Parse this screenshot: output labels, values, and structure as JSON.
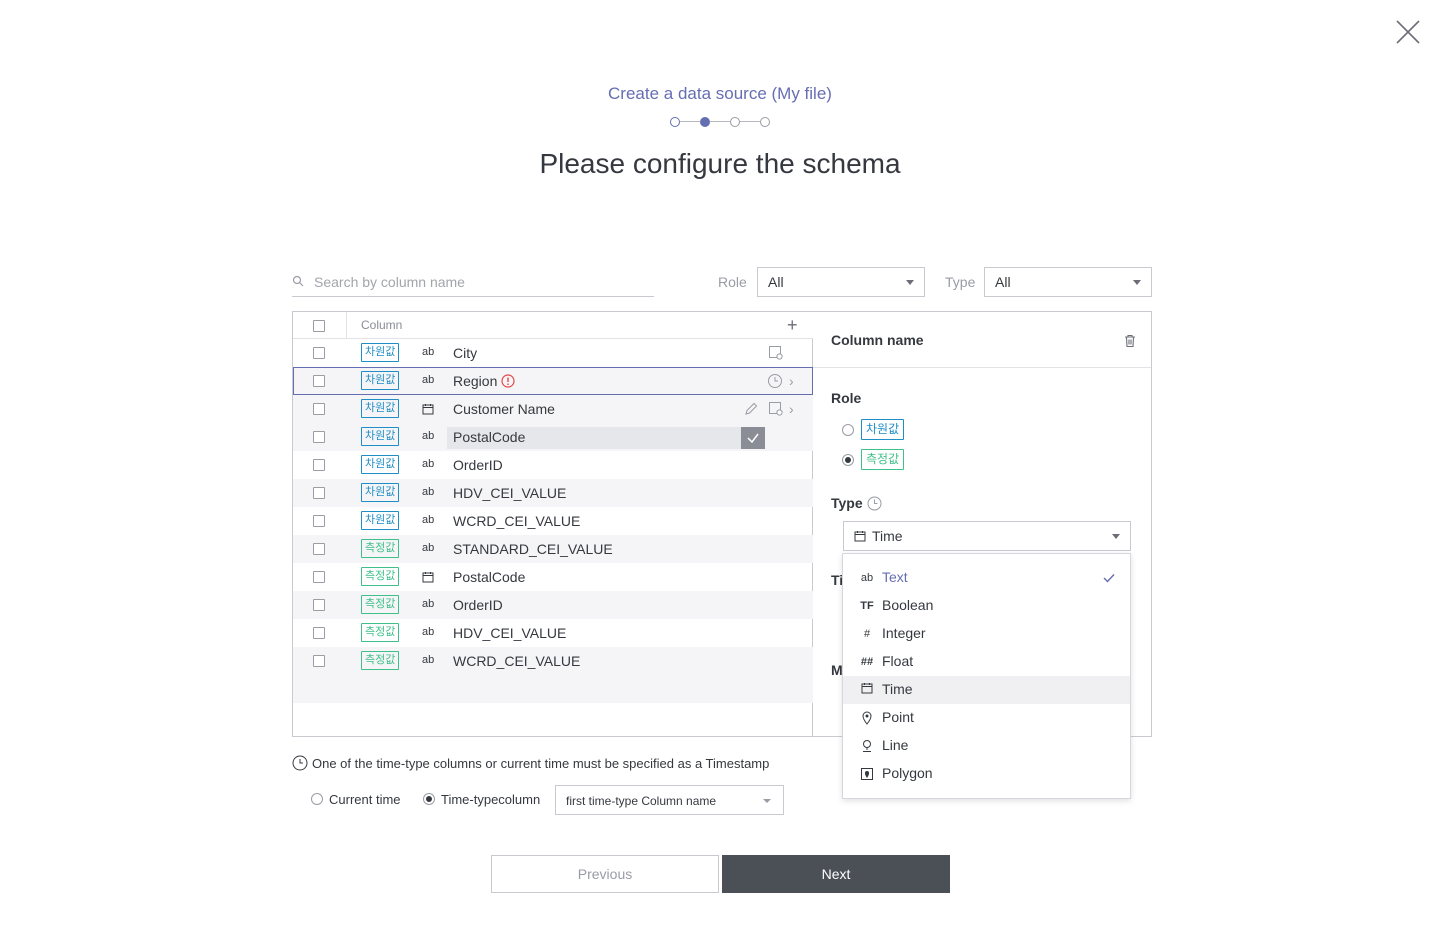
{
  "header": {
    "subtitle": "Create a data source (My file)",
    "title": "Please configure the schema",
    "steps_total": 4,
    "steps_current": 2
  },
  "filters": {
    "search_placeholder": "Search by column name",
    "role_label": "Role",
    "role_value": "All",
    "type_label": "Type",
    "type_value": "All"
  },
  "grid": {
    "column_header": "Column",
    "add_label": "+",
    "rows": [
      {
        "role": "차원값",
        "role_kind": "dimension",
        "type_icon": "ab",
        "name": "City"
      },
      {
        "role": "차원값",
        "role_kind": "dimension",
        "type_icon": "ab",
        "name": "Region"
      },
      {
        "role": "차원값",
        "role_kind": "dimension",
        "type_icon": "calendar",
        "name": "Customer Name"
      },
      {
        "role": "차원값",
        "role_kind": "dimension",
        "type_icon": "ab",
        "name": "PostalCode"
      },
      {
        "role": "차원값",
        "role_kind": "dimension",
        "type_icon": "ab",
        "name": "OrderID"
      },
      {
        "role": "차원값",
        "role_kind": "dimension",
        "type_icon": "ab",
        "name": "HDV_CEI_VALUE"
      },
      {
        "role": "차원값",
        "role_kind": "dimension",
        "type_icon": "ab",
        "name": "WCRD_CEI_VALUE"
      },
      {
        "role": "측정값",
        "role_kind": "measure",
        "type_icon": "ab",
        "name": "STANDARD_CEI_VALUE"
      },
      {
        "role": "측정값",
        "role_kind": "measure",
        "type_icon": "calendar",
        "name": "PostalCode"
      },
      {
        "role": "측정값",
        "role_kind": "measure",
        "type_icon": "ab",
        "name": "OrderID"
      },
      {
        "role": "측정값",
        "role_kind": "measure",
        "type_icon": "ab",
        "name": "HDV_CEI_VALUE"
      },
      {
        "role": "측정값",
        "role_kind": "measure",
        "type_icon": "ab",
        "name": "WCRD_CEI_VALUE"
      }
    ]
  },
  "detail": {
    "title": "Column name",
    "role_label": "Role",
    "role_dimension": "차원값",
    "role_measure": "측정값",
    "role_selected": "측정값",
    "type_label": "Type",
    "type_value": "Time",
    "hidden_label_1": "Ti",
    "hidden_label_2": "M"
  },
  "type_dropdown": {
    "items": [
      {
        "icon": "ab",
        "label": "Text",
        "checked": true
      },
      {
        "icon": "TF",
        "label": "Boolean"
      },
      {
        "icon": "#",
        "label": "Integer"
      },
      {
        "icon": "##",
        "label": "Float"
      },
      {
        "icon": "calendar",
        "label": "Time",
        "hover": true
      },
      {
        "icon": "point",
        "label": "Point"
      },
      {
        "icon": "line",
        "label": "Line"
      },
      {
        "icon": "polygon",
        "label": "Polygon"
      }
    ]
  },
  "timestamp": {
    "note": "One of the time-type columns or current time must be specified as a Timestamp",
    "option_current": "Current time",
    "option_column": "Time-typecolumn",
    "selected": "Time-typecolumn",
    "column_select": "first time-type Column name"
  },
  "footer": {
    "previous": "Previous",
    "next": "Next"
  },
  "colors": {
    "accent": "#666eb2",
    "dimension": "#1f8dc6",
    "measure": "#3fbf8a",
    "warning": "#e04848",
    "dark_button": "#4b4f56"
  }
}
